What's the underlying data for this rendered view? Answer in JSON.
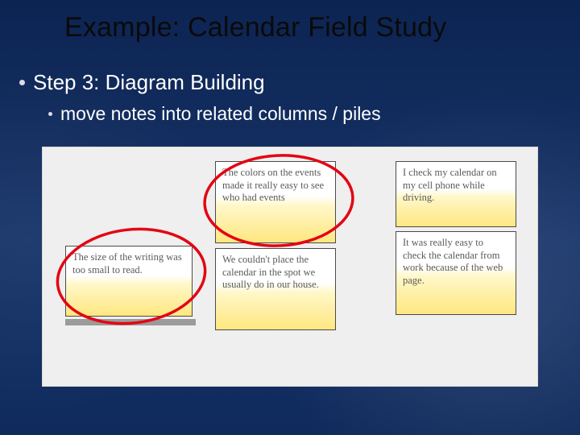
{
  "title": "Example: Calendar Field Study",
  "bullet1": "Step 3: Diagram Building",
  "bullet2": "move notes into related columns / piles",
  "notes": {
    "n1": "The size of the writing was too small to read.",
    "n2": "The colors on the events made it really easy to see who had events",
    "n3": "We couldn't place the calendar in the spot we usually do in our house.",
    "n4": "I check my calendar on my cell phone while driving.",
    "n5": "It was really easy to check the calendar from work because of the web page."
  }
}
